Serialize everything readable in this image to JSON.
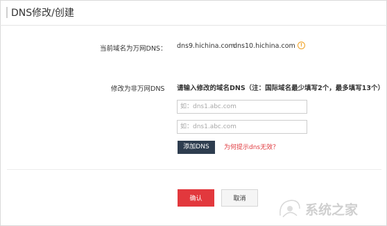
{
  "header": {
    "title": "DNS修改/创建"
  },
  "current_dns": {
    "label": "当前域名为万网DNS：",
    "values": [
      "dns9.hichina.com",
      "dns10.hichina.com"
    ],
    "info_icon": "info-circle-icon"
  },
  "modify": {
    "label": "修改为非万网DNS",
    "instruction": "请输入修改的域名DNS（注：国际域名最少填写2个，最多填写13个）",
    "inputs": [
      {
        "placeholder": "如：dns1.abc.com",
        "value": ""
      },
      {
        "placeholder": "如：dns1.abc.com",
        "value": ""
      }
    ],
    "add_button": "添加DNS",
    "help_link": "为何提示dns无效？"
  },
  "footer": {
    "confirm_label": "确认",
    "cancel_label": "取消"
  },
  "watermark": {
    "text": "系统之家"
  },
  "colors": {
    "accent_red": "#e2383d",
    "dark_button": "#2e3d4f",
    "link_red": "#e0393e",
    "info_orange": "#f0a020"
  }
}
